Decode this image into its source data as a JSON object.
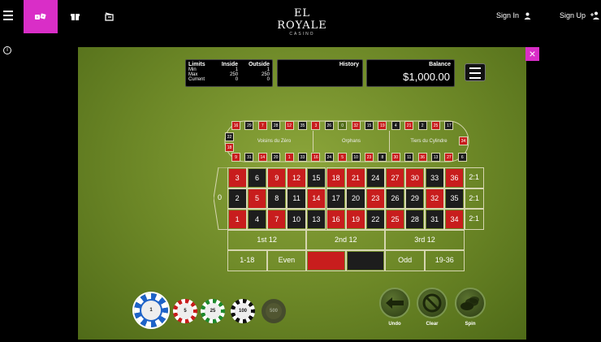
{
  "header": {
    "logo_name": "EL ROYALE",
    "logo_sub": "CASINO",
    "sign_in": "Sign In",
    "sign_up": "Sign Up",
    "accent": "#d92ec7"
  },
  "close_label": "×",
  "limits": {
    "col_label": "Limits",
    "col_inside": "Inside",
    "col_outside": "Outside",
    "rows": [
      {
        "label": "Min",
        "inside": "1",
        "outside": "1"
      },
      {
        "label": "Max",
        "inside": "250",
        "outside": "250"
      },
      {
        "label": "Current",
        "inside": "0",
        "outside": "0"
      }
    ]
  },
  "history_title": "History",
  "balance": {
    "title": "Balance",
    "value": "$1,000.00"
  },
  "racetrack": {
    "top": [
      "16",
      "29",
      "7",
      "28",
      "12",
      "35",
      "3",
      "26",
      "0",
      "32",
      "15",
      "19",
      "4",
      "21",
      "2",
      "25",
      "17"
    ],
    "bottom": [
      "9",
      "31",
      "14",
      "20",
      "1",
      "33",
      "16",
      "24",
      "5",
      "10",
      "23",
      "8",
      "30",
      "11",
      "36",
      "13",
      "27",
      "6"
    ],
    "left": [
      "22",
      "18"
    ],
    "right": [
      "34"
    ],
    "zones": [
      "Voisins du Zéro",
      "Orphans",
      "Tiers du Cylindre"
    ]
  },
  "table": {
    "zero": "0",
    "row_top": [
      "3",
      "6",
      "9",
      "12",
      "15",
      "18",
      "21",
      "24",
      "27",
      "30",
      "33",
      "36"
    ],
    "row_mid": [
      "2",
      "5",
      "8",
      "11",
      "14",
      "17",
      "20",
      "23",
      "26",
      "29",
      "32",
      "35"
    ],
    "row_bot": [
      "1",
      "4",
      "7",
      "10",
      "13",
      "16",
      "19",
      "22",
      "25",
      "28",
      "31",
      "34"
    ],
    "column_bet": "2:1",
    "dozens": [
      "1st 12",
      "2nd 12",
      "3rd 12"
    ],
    "outside": [
      "1-18",
      "Even",
      "Odd",
      "19-36"
    ],
    "red_numbers": [
      "1",
      "3",
      "5",
      "7",
      "9",
      "12",
      "14",
      "16",
      "18",
      "19",
      "21",
      "23",
      "25",
      "27",
      "30",
      "32",
      "34",
      "36"
    ],
    "red_color": "#c81d1d",
    "black_color": "#1d1d1d"
  },
  "chips": [
    "1",
    "5",
    "25",
    "100",
    "500"
  ],
  "controls": {
    "undo": "Undo",
    "clear": "Clear",
    "spin": "Spin"
  }
}
